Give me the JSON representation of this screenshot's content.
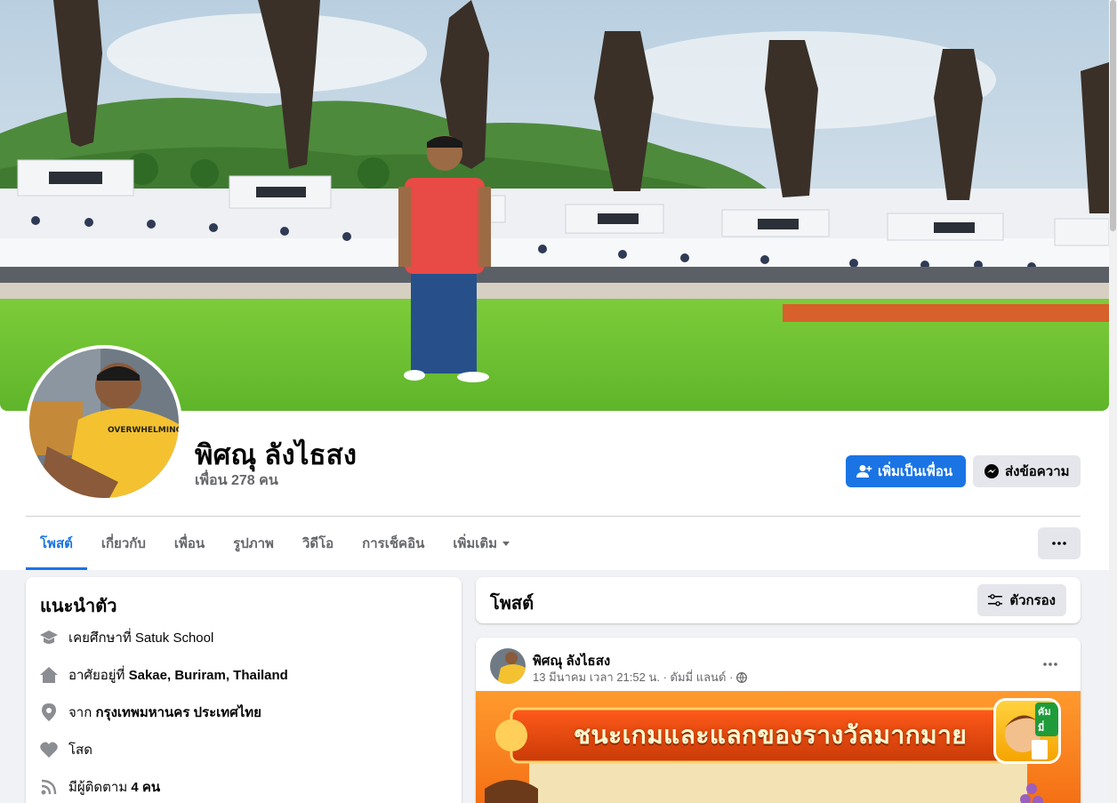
{
  "profile": {
    "name": "พิศณุ ลังไธสง",
    "friends": "เพื่อน 278 คน"
  },
  "actions": {
    "add_friend": "เพิ่มเป็นเพื่อน",
    "message": "ส่งข้อความ"
  },
  "tabs": [
    {
      "label": "โพสต์",
      "active": true
    },
    {
      "label": "เกี่ยวกับ"
    },
    {
      "label": "เพื่อน"
    },
    {
      "label": "รูปภาพ"
    },
    {
      "label": "วิดีโอ"
    },
    {
      "label": "การเช็คอิน"
    },
    {
      "label": "เพิ่มเติม"
    }
  ],
  "intro": {
    "title": "แนะนำตัว",
    "items": [
      {
        "icon": "graduation-cap-icon",
        "prefix": "เคยศึกษาที่ Satuk School",
        "bold": ""
      },
      {
        "icon": "home-icon",
        "prefix": "อาศัยอยู่ที่ ",
        "bold": "Sakae, Buriram, Thailand"
      },
      {
        "icon": "location-pin-icon",
        "prefix": "จาก ",
        "bold": "กรุงเทพมหานคร ประเทศไทย"
      },
      {
        "icon": "heart-icon",
        "prefix": "โสด",
        "bold": ""
      },
      {
        "icon": "rss-icon",
        "prefix": "มีผู้ติดตาม ",
        "bold": "4 คน"
      }
    ]
  },
  "posts": {
    "title": "โพสต์",
    "filter": "ตัวกรอง",
    "item": {
      "author": "พิศณุ ลังไธสง",
      "meta": "13 มีนาคม เวลา 21:52 น. · ดัมมี่ แลนด์ ·",
      "banner_text": "ชนะเกมและแลกของรางวัลมากมาย",
      "badge_text": "คัมมี่"
    }
  },
  "colors": {
    "accent": "#1b74e4",
    "page_bg": "#f0f2f5",
    "secondary_btn": "#e4e6eb",
    "muted_text": "#65676b"
  }
}
